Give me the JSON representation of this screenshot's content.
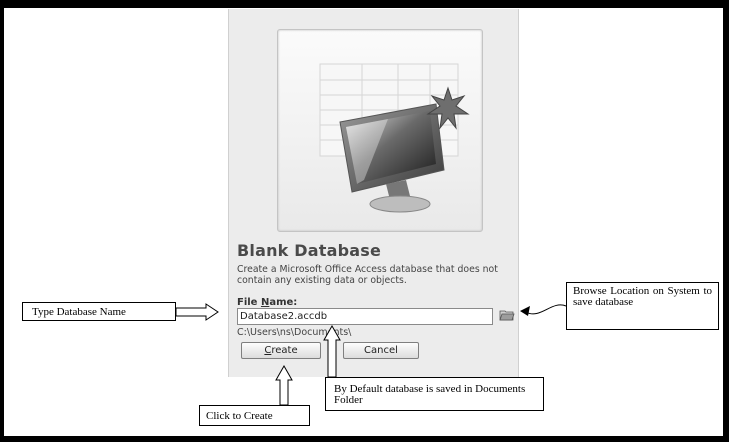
{
  "dialog": {
    "title": "Blank Database",
    "description": "Create a Microsoft Office Access database that does not contain any existing data or objects.",
    "file_name_label_prefix": "File ",
    "file_name_label_accel": "N",
    "file_name_label_suffix": "ame:",
    "file_name_value": "Database2.accdb",
    "path": "C:\\Users\\ns\\Documents\\",
    "create_button_accel": "C",
    "create_button_rest": "reate",
    "cancel_button": "Cancel",
    "folder_icon": "browse-folder-icon"
  },
  "callouts": {
    "type_name": "Type Database Name",
    "browse": "Browse Location on System to save database",
    "default_location": "By Default database is saved in Documents Folder",
    "click_create": "Click to Create"
  },
  "colors": {
    "dialog_background": "#ececec",
    "frame": "#000000"
  }
}
